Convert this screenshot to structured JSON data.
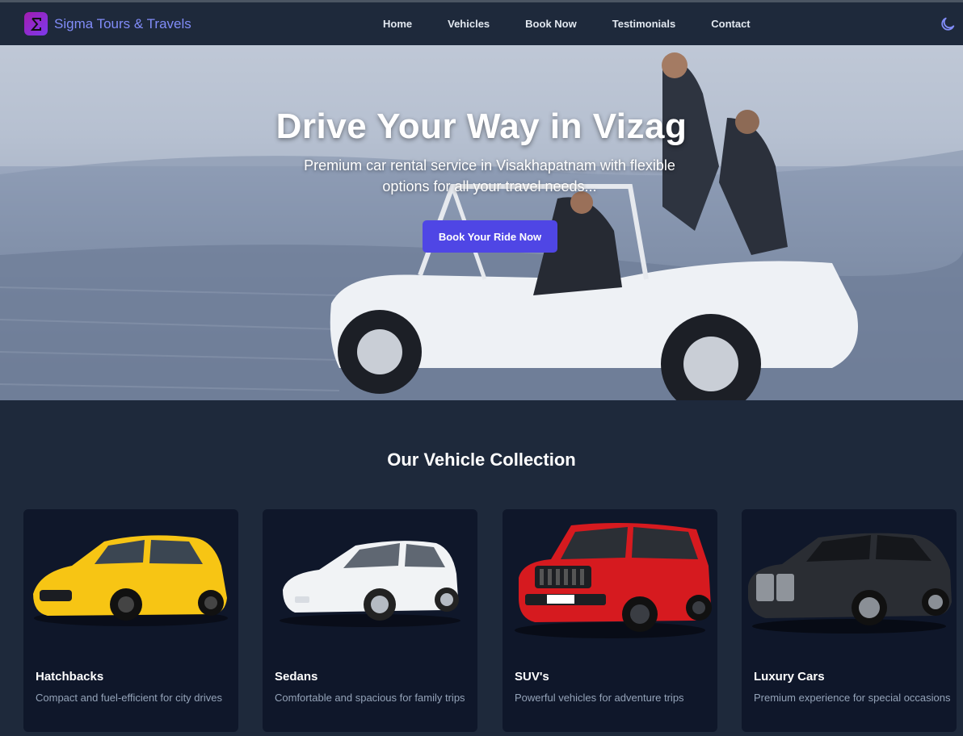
{
  "header": {
    "brand": "Sigma Tours & Travels",
    "logo_icon": "sigma-icon",
    "nav": [
      "Home",
      "Vehicles",
      "Book Now",
      "Testimonials",
      "Contact"
    ],
    "theme_icon": "moon-icon"
  },
  "hero": {
    "title": "Drive Your Way in Vizag",
    "subtitle": "Premium car rental service in Visakhapatnam with flexible options for all your travel needs...",
    "cta": "Book Your Ride Now"
  },
  "collection": {
    "title": "Our Vehicle Collection",
    "cards": [
      {
        "title": "Hatchbacks",
        "description": "Compact and fuel-efficient for city drives",
        "color": "#f7c514"
      },
      {
        "title": "Sedans",
        "description": "Comfortable and spacious for family trips",
        "color": "#f1f3f5"
      },
      {
        "title": "SUV's",
        "description": "Powerful vehicles for adventure trips",
        "color": "#d61a1f"
      },
      {
        "title": "Luxury Cars",
        "description": "Premium experience for special occasions",
        "color": "#2a2d33"
      }
    ]
  },
  "colors": {
    "accent": "#4f46e5",
    "brand": "#818cf8",
    "bg": "#1e293b",
    "card": "#0f172a"
  }
}
